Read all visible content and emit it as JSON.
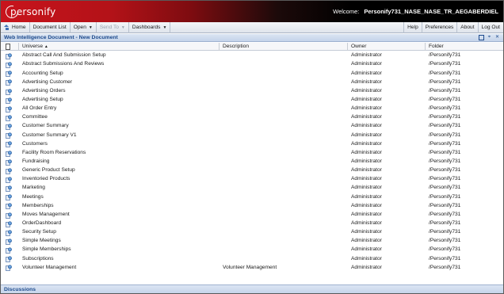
{
  "header": {
    "logo_text": "personify",
    "welcome_label": "Welcome:",
    "user_name": "Personify731_NASE_NASE_TR_AEGABERDIEL"
  },
  "toolbar": {
    "home": "Home",
    "document_list": "Document List",
    "open": "Open",
    "send_to": "Send To",
    "dashboards": "Dashboards",
    "help": "Help",
    "preferences": "Preferences",
    "about": "About",
    "logout": "Log Out"
  },
  "panel": {
    "title": "Web Intelligence Document - New Document"
  },
  "columns": {
    "universe": "Universe",
    "sort_indicator": "▲",
    "description": "Description",
    "owner": "Owner",
    "folder": "Folder"
  },
  "rows": [
    {
      "universe": "Abstract Call And Submission Setup",
      "description": "",
      "owner": "Administrator",
      "folder": "/Personify731"
    },
    {
      "universe": "Abstract Submissions And Reviews",
      "description": "",
      "owner": "Administrator",
      "folder": "/Personify731"
    },
    {
      "universe": "Accounting Setup",
      "description": "",
      "owner": "Administrator",
      "folder": "/Personify731"
    },
    {
      "universe": "Advertising Customer",
      "description": "",
      "owner": "Administrator",
      "folder": "/Personify731"
    },
    {
      "universe": "Advertising Orders",
      "description": "",
      "owner": "Administrator",
      "folder": "/Personify731"
    },
    {
      "universe": "Advertising Setup",
      "description": "",
      "owner": "Administrator",
      "folder": "/Personify731"
    },
    {
      "universe": "All Order Entry",
      "description": "",
      "owner": "Administrator",
      "folder": "/Personify731"
    },
    {
      "universe": "Committee",
      "description": "",
      "owner": "Administrator",
      "folder": "/Personify731"
    },
    {
      "universe": "Customer Summary",
      "description": "",
      "owner": "Administrator",
      "folder": "/Personify731"
    },
    {
      "universe": "Customer Summary V1",
      "description": "",
      "owner": "Administrator",
      "folder": "/Personify731"
    },
    {
      "universe": "Customers",
      "description": "",
      "owner": "Administrator",
      "folder": "/Personify731"
    },
    {
      "universe": "Facility Room Reservations",
      "description": "",
      "owner": "Administrator",
      "folder": "/Personify731"
    },
    {
      "universe": "Fundraising",
      "description": "",
      "owner": "Administrator",
      "folder": "/Personify731"
    },
    {
      "universe": "Generic Product Setup",
      "description": "",
      "owner": "Administrator",
      "folder": "/Personify731"
    },
    {
      "universe": "Inventoried Products",
      "description": "",
      "owner": "Administrator",
      "folder": "/Personify731"
    },
    {
      "universe": "Marketing",
      "description": "",
      "owner": "Administrator",
      "folder": "/Personify731"
    },
    {
      "universe": "Meetings",
      "description": "",
      "owner": "Administrator",
      "folder": "/Personify731"
    },
    {
      "universe": "Memberships",
      "description": "",
      "owner": "Administrator",
      "folder": "/Personify731"
    },
    {
      "universe": "Moves Management",
      "description": "",
      "owner": "Administrator",
      "folder": "/Personify731"
    },
    {
      "universe": "OrderDashboard",
      "description": "",
      "owner": "Administrator",
      "folder": "/Personify731"
    },
    {
      "universe": "Security Setup",
      "description": "",
      "owner": "Administrator",
      "folder": "/Personify731"
    },
    {
      "universe": "Simple Meetings",
      "description": "",
      "owner": "Administrator",
      "folder": "/Personify731"
    },
    {
      "universe": "Simple Memberships",
      "description": "",
      "owner": "Administrator",
      "folder": "/Personify731"
    },
    {
      "universe": "Subscriptions",
      "description": "",
      "owner": "Administrator",
      "folder": "/Personify731"
    },
    {
      "universe": "Volunteer Management",
      "description": "Volunteer Management",
      "owner": "Administrator",
      "folder": "/Personify731"
    }
  ],
  "bottom_panel": {
    "title": "Discussions"
  },
  "colors": {
    "brand_red": "#c8141c",
    "panel_title_blue": "#1d4a8c"
  },
  "icons": {
    "row": "universe-icon",
    "home": "home-icon"
  }
}
